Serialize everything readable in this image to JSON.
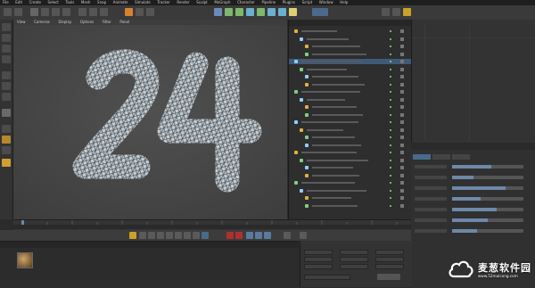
{
  "menubar": {
    "items": [
      "File",
      "Edit",
      "Create",
      "Select",
      "Tools",
      "Mesh",
      "Snap",
      "Animate",
      "Simulate",
      "Tracker",
      "Render",
      "Sculpt",
      "MoGraph",
      "Character",
      "Pipeline",
      "Plugins",
      "Script",
      "Window",
      "Help"
    ]
  },
  "viewport": {
    "menu": [
      "View",
      "Cameras",
      "Display",
      "Options",
      "Filter",
      "Panel"
    ]
  },
  "objects": {
    "rows": [
      {
        "name": "",
        "color": "#e0b040"
      },
      {
        "name": "",
        "color": "#8fd0ff"
      },
      {
        "name": "",
        "color": "#e0b040"
      },
      {
        "name": "",
        "color": "#7fd07f"
      },
      {
        "name": "",
        "color": "#8fd0ff"
      },
      {
        "name": "",
        "color": "#7fd07f"
      },
      {
        "name": "",
        "color": "#8fd0ff"
      },
      {
        "name": "",
        "color": "#e0b040"
      },
      {
        "name": "",
        "color": "#7fd07f"
      },
      {
        "name": "",
        "color": "#8fd0ff"
      },
      {
        "name": "",
        "color": "#e0b040"
      },
      {
        "name": "",
        "color": "#7fd07f"
      },
      {
        "name": "",
        "color": "#8fd0ff"
      },
      {
        "name": "",
        "color": "#e0b040"
      },
      {
        "name": "",
        "color": "#7fd07f"
      },
      {
        "name": "",
        "color": "#8fd0ff"
      },
      {
        "name": "",
        "color": "#e0b040"
      },
      {
        "name": "",
        "color": "#7fd07f"
      },
      {
        "name": "",
        "color": "#8fd0ff"
      },
      {
        "name": "",
        "color": "#e0b040"
      },
      {
        "name": "",
        "color": "#7fd07f"
      },
      {
        "name": "",
        "color": "#8fd0ff"
      },
      {
        "name": "",
        "color": "#e0b040"
      },
      {
        "name": "",
        "color": "#7fd07f"
      }
    ],
    "selected_index": 4
  },
  "attributes": {
    "sliders": [
      0.55,
      0.3,
      0.75,
      0.4,
      0.62,
      0.5,
      0.35
    ]
  },
  "watermark": {
    "title": "麦葱软件园",
    "url": "www.52maicong.com"
  },
  "colors": {
    "accent": "#6d88a8",
    "selection": "#3e5a78",
    "orange": "#e08a2a"
  }
}
